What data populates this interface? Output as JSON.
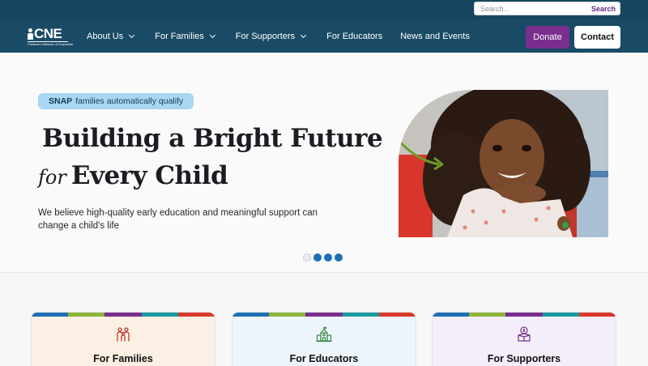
{
  "search": {
    "placeholder": "Search...",
    "button_label": "Search"
  },
  "logo": {
    "text": "CNE",
    "tagline": "Childcare Network of Evansville"
  },
  "nav": {
    "items": [
      {
        "label": "About Us",
        "has_dropdown": true
      },
      {
        "label": "For Families",
        "has_dropdown": true
      },
      {
        "label": "For Supporters",
        "has_dropdown": true
      },
      {
        "label": "For Educators",
        "has_dropdown": false
      },
      {
        "label": "News and Events",
        "has_dropdown": false
      }
    ],
    "donate_label": "Donate",
    "contact_label": "Contact"
  },
  "hero": {
    "badge_bold": "SNAP",
    "badge_text": "families automatically qualify",
    "title_line1": "Building a Bright Future",
    "title_for": "for",
    "title_line2": "Every Child",
    "lede": "We believe high-quality early education and meaningful support can change a child's life",
    "carousel": {
      "slides": 4,
      "active_index": 0
    }
  },
  "cards": [
    {
      "title": "For Families",
      "icon": "family-icon"
    },
    {
      "title": "For Educators",
      "icon": "school-icon"
    },
    {
      "title": "For Supporters",
      "icon": "donation-box-icon"
    }
  ],
  "colors": {
    "utility_bar": "#164660",
    "nav_bar": "#1a4b66",
    "donate": "#7a2e8e",
    "badge": "#a9d6f2",
    "carousel_dot": "#1a6fb7",
    "stripe": [
      "#1f6fb4",
      "#8fb43a",
      "#7a2e8e",
      "#1b9aa0",
      "#d8392b"
    ]
  }
}
